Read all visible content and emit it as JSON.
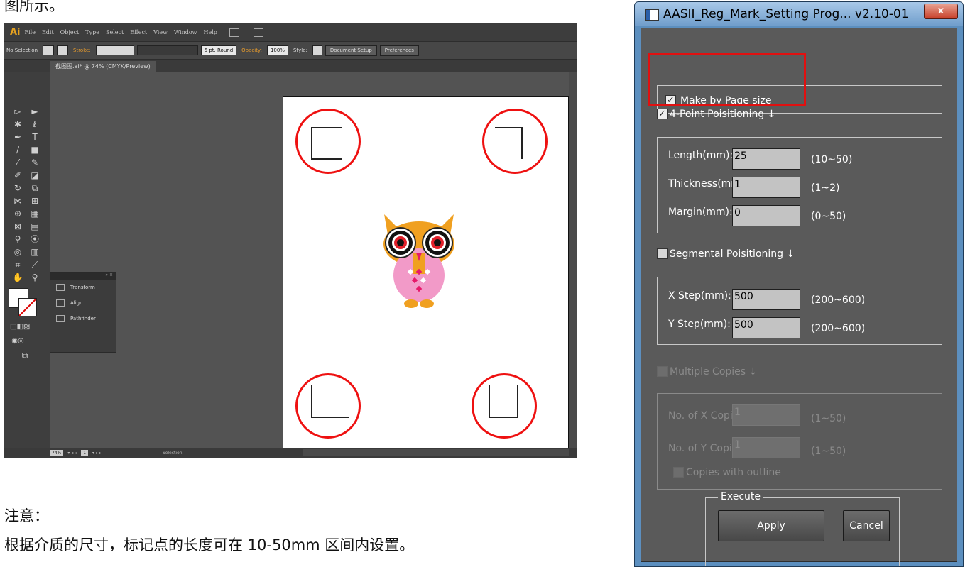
{
  "document": {
    "top_text": "图所示。",
    "note_label": "注意：",
    "body_text": "根据介质的尺寸，标记点的长度可在 10-50mm 区间内设置。"
  },
  "illustrator": {
    "logo": "Ai",
    "menus": [
      "File",
      "Edit",
      "Object",
      "Type",
      "Select",
      "Effect",
      "View",
      "Window",
      "Help"
    ],
    "control_bar": {
      "selection": "No Selection",
      "stroke_label": "Stroke:",
      "brush": "5 pt. Round",
      "opacity_label": "Opacity:",
      "opacity_value": "100%",
      "style_label": "Style:",
      "document_setup": "Document Setup",
      "preferences": "Preferences"
    },
    "doc_tab": "截图图.ai* @ 74% (CMYK/Preview)",
    "panel": {
      "items": [
        "Transform",
        "Align",
        "Pathfinder"
      ]
    },
    "status_bar": {
      "zoom": "74%",
      "page": "1",
      "mode": "Selection"
    },
    "colors": {
      "registration_circle": "#e11111",
      "owl_body": "#f0a020",
      "owl_belly": "#f29ac8"
    }
  },
  "dialog": {
    "title": "AASII_Reg_Mark_Setting Prog... v2.10-01",
    "close_label": "x",
    "make_by_page_size": {
      "label": "Make by Page size",
      "checked": true
    },
    "four_point": {
      "label": "4-Point Poisitioning ↓",
      "checked": true
    },
    "length": {
      "label": "Length(mm):",
      "value": "25",
      "range": "(10~50)"
    },
    "thickness": {
      "label": "Thickness(mm):",
      "value": "1",
      "range": "(1~2)"
    },
    "margin": {
      "label": "Margin(mm):",
      "value": "0",
      "range": "(0~50)"
    },
    "segmental": {
      "label": "Segmental Poisitioning ↓",
      "checked": false
    },
    "x_step": {
      "label": "X Step(mm):",
      "value": "500",
      "range": "(200~600)"
    },
    "y_step": {
      "label": "Y Step(mm):",
      "value": "500",
      "range": "(200~600)"
    },
    "multiple_copies": {
      "label": "Multiple Copies ↓",
      "checked": false
    },
    "x_copies": {
      "label": "No. of X Copies:",
      "value": "1",
      "range": "(1~50)"
    },
    "y_copies": {
      "label": "No. of Y Copies:",
      "value": "1",
      "range": "(1~50)"
    },
    "copies_outline": {
      "label": "Copies with outline",
      "checked": false
    },
    "execute_group": "Execute",
    "apply_label": "Apply",
    "cancel_label": "Cancel"
  }
}
